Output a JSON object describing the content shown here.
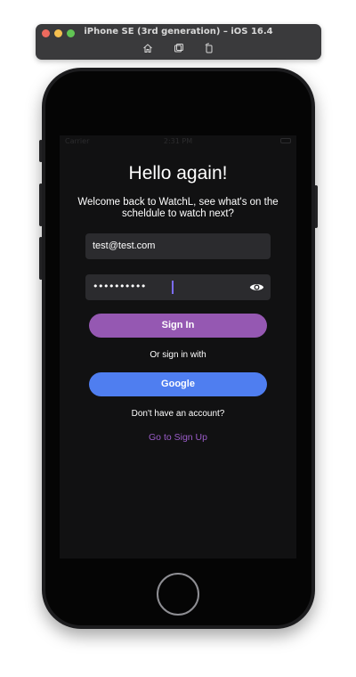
{
  "simulator": {
    "title": "iPhone SE (3rd generation) – iOS 16.4",
    "tools": [
      "home-icon",
      "screenshot-icon",
      "rotate-icon"
    ]
  },
  "status_bar": {
    "carrier": "Carrier",
    "time": "2:31 PM"
  },
  "login": {
    "title": "Hello again!",
    "subtitle": "Welcome back to WatchL, see what's on the scheldule to watch next?",
    "email_value": "test@test.com",
    "password_mask": "••••••••••",
    "sign_in_label": "Sign In",
    "or_text": "Or sign in with",
    "google_label": "Google",
    "no_account_text": "Don't have an account?",
    "signup_link": "Go to Sign Up"
  },
  "colors": {
    "screen_bg": "#111112",
    "field_bg": "#2b2b2e",
    "sign_in_button": "#9558b2",
    "google_button": "#4f7ef0",
    "signup_link": "#9a5cc8",
    "caret": "#7b6cf6"
  }
}
